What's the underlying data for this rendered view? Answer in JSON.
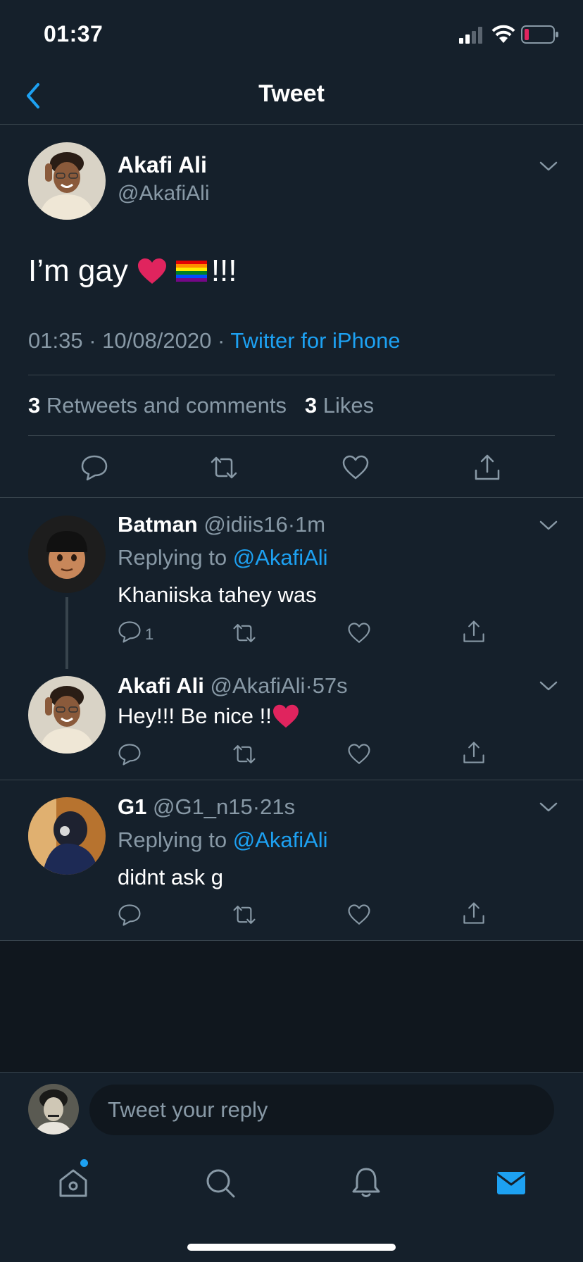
{
  "status_bar": {
    "time": "01:37"
  },
  "nav": {
    "title": "Tweet"
  },
  "main_tweet": {
    "name": "Akafi Ali",
    "handle": "@AkafiAli",
    "text": "I’m gay",
    "text_suffix": "!!!",
    "time": "01:35",
    "date": "10/08/2020",
    "source": "Twitter for iPhone",
    "retweets_count": "3",
    "retweets_label": "Retweets and comments",
    "likes_count": "3",
    "likes_label": "Likes"
  },
  "replies": [
    {
      "name": "Batman",
      "handle": "@idiis16",
      "age": "1m",
      "replying_label": "Replying to",
      "replying_to": "@AkafiAli",
      "text": "Khaniiska tahey was",
      "reply_count": "1"
    },
    {
      "name": "Akafi Ali",
      "handle": "@AkafiAli",
      "age": "57s",
      "text": "Hey!!! Be nice !!"
    },
    {
      "name": "G1",
      "handle": "@G1_n15",
      "age": "21s",
      "replying_label": "Replying to",
      "replying_to": "@AkafiAli",
      "text": "didnt ask g"
    }
  ],
  "compose": {
    "placeholder": "Tweet your reply"
  },
  "separator": "·",
  "colors": {
    "background": "#15202b",
    "accent": "#1da1f2",
    "muted": "#8899a6",
    "divider": "#38444d"
  }
}
